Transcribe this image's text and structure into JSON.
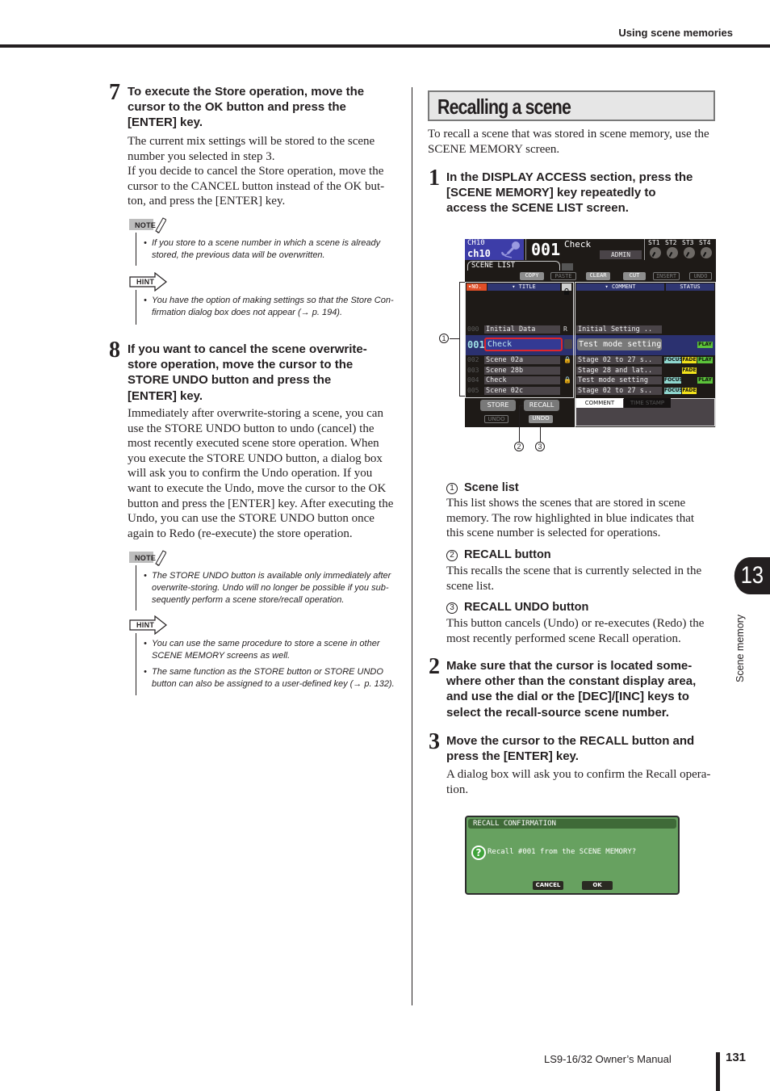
{
  "header": {
    "running_title": "Using scene memories"
  },
  "left_column": {
    "step7": {
      "number": "7",
      "title_lines": [
        "To execute the Store operation, move the",
        "cursor to the OK button and press the",
        "[ENTER] key."
      ],
      "body_lines": [
        "The current mix settings will be stored to the scene",
        "number you selected in step 3.",
        "If you decide to cancel the Store operation, move the",
        "cursor to the CANCEL button instead of the OK but-",
        "ton, and press the [ENTER] key."
      ]
    },
    "note1": {
      "tag": "NOTE",
      "bullets": [
        [
          "If you store to a scene number in which a scene is already",
          "stored, the previous data will be overwritten."
        ]
      ]
    },
    "hint1": {
      "tag": "HINT",
      "bullets": [
        [
          "You have the option of making settings so that the Store Con-",
          "firmation dialog box does not appear (→ p. 194)."
        ]
      ]
    },
    "step8": {
      "number": "8",
      "title_lines": [
        "If you want to cancel the scene overwrite-",
        "store operation, move the cursor to the",
        "STORE UNDO button and press the",
        "[ENTER] key."
      ],
      "body_lines": [
        "Immediately after overwrite-storing a scene, you can",
        "use the STORE UNDO button to undo (cancel) the",
        "most recently executed scene store operation. When",
        "you execute the STORE UNDO button, a dialog box",
        "will ask you to confirm the Undo operation. If you",
        "want to execute the Undo, move the cursor to the OK",
        "button and press the [ENTER] key. After executing the",
        "Undo, you can use the STORE UNDO button once",
        "again to Redo (re-execute) the store operation."
      ]
    },
    "note2": {
      "tag": "NOTE",
      "bullets": [
        [
          "The STORE UNDO button is available only immediately after",
          "overwrite-storing. Undo will no longer be possible if you sub-",
          "sequently perform a scene store/recall operation."
        ]
      ]
    },
    "hint2": {
      "tag": "HINT",
      "bullets": [
        [
          "You can use the same procedure to store a scene in other",
          "SCENE MEMORY screens as well."
        ],
        [
          "The same function as the STORE button or STORE UNDO",
          "button can also be assigned to a user-defined key (→ p. 132)."
        ]
      ]
    }
  },
  "right_column": {
    "section_title": "Recalling a scene",
    "intro_lines": [
      "To recall a scene that was stored in scene memory, use the",
      "SCENE MEMORY screen."
    ],
    "step1": {
      "number": "1",
      "title_lines": [
        "In the DISPLAY ACCESS section, press the",
        "[SCENE MEMORY] key repeatedly to",
        "access the SCENE LIST screen."
      ]
    },
    "items": [
      {
        "callout": "1",
        "title": "Scene list",
        "body_lines": [
          "This list shows the scenes that are stored in scene",
          "memory. The row highlighted in blue indicates that",
          "this scene number is selected for operations."
        ]
      },
      {
        "callout": "2",
        "title": "RECALL button",
        "body_lines": [
          "This recalls the scene that is currently selected in the",
          "scene list."
        ]
      },
      {
        "callout": "3",
        "title": "RECALL UNDO button",
        "body_lines": [
          "This button cancels (Undo) or re-executes (Redo) the",
          "most recently performed scene Recall operation."
        ]
      }
    ],
    "step2": {
      "number": "2",
      "title_lines": [
        "Make sure that the cursor is located some-",
        "where other than the constant display area,",
        "and use the dial or the [DEC]/[INC] keys to",
        "select the recall-source scene number."
      ]
    },
    "step3": {
      "number": "3",
      "title_lines": [
        "Move the cursor to the RECALL button and",
        "press the [ENTER] key."
      ],
      "body_lines": [
        "A dialog box will ask you to confirm the Recall opera-",
        "tion."
      ]
    }
  },
  "scene_list_screen": {
    "channel_top": "CH10",
    "channel_name": "ch10",
    "scene_number": "001",
    "scene_title": "Check",
    "user": "ADMIN",
    "st_labels": [
      "ST1",
      "ST2",
      "ST3",
      "ST4"
    ],
    "tab": "SCENE LIST",
    "toolbar": [
      {
        "label": "COPY",
        "enabled": true
      },
      {
        "label": "PASTE",
        "enabled": false
      },
      {
        "label": "CLEAR",
        "enabled": true
      },
      {
        "label": "CUT",
        "enabled": true
      },
      {
        "label": "INSERT",
        "enabled": false
      },
      {
        "label": "UNDO",
        "enabled": false
      }
    ],
    "columns": {
      "no": "▾NO.",
      "title": "▾ TITLE",
      "comment": "▾ COMMENT",
      "status": "STATUS"
    },
    "rows": [
      {
        "no": "000",
        "title": "Initial Data",
        "lock": "R",
        "comment": "Initial Setting ..",
        "focus": false,
        "fade": false,
        "play": false
      },
      {
        "no": "001",
        "title": "Check",
        "lock": "",
        "comment": "Test mode setting",
        "focus": false,
        "fade": false,
        "play": true,
        "selected": true
      },
      {
        "no": "002",
        "title": "Scene 02a",
        "lock": "🔒",
        "comment": "Stage 02 to 27 s..",
        "focus": true,
        "fade": true,
        "play": true
      },
      {
        "no": "003",
        "title": "Scene 28b",
        "lock": "",
        "comment": "Stage 28 and lat..",
        "focus": false,
        "fade": true,
        "play": false
      },
      {
        "no": "004",
        "title": "Check",
        "lock": "🔒",
        "comment": "Test mode setting",
        "focus": true,
        "fade": false,
        "play": true
      },
      {
        "no": "005",
        "title": "Scene 02c",
        "lock": "",
        "comment": "Stage 02 to 27 s..",
        "focus": true,
        "fade": true,
        "play": false
      }
    ],
    "badges": {
      "focus": "FOCUS",
      "fade": "FADE",
      "play": "PLAY"
    },
    "store_label": "STORE",
    "recall_label": "RECALL",
    "store_undo_label": "UNDO",
    "recall_undo_label": "UNDO",
    "comment_tab": "COMMENT",
    "timestamp_tab": "TIME STAMP",
    "callouts": [
      "1",
      "2",
      "3"
    ]
  },
  "recall_dialog": {
    "title": "RECALL CONFIRMATION",
    "icon": "question-icon",
    "message": "Recall #001 from the SCENE MEMORY?",
    "cancel_label": "CANCEL",
    "ok_label": "OK"
  },
  "chapter": {
    "number": "13",
    "label": "Scene memory"
  },
  "footer": {
    "manual_title": "LS9-16/32  Owner’s Manual",
    "page_number": "131"
  }
}
